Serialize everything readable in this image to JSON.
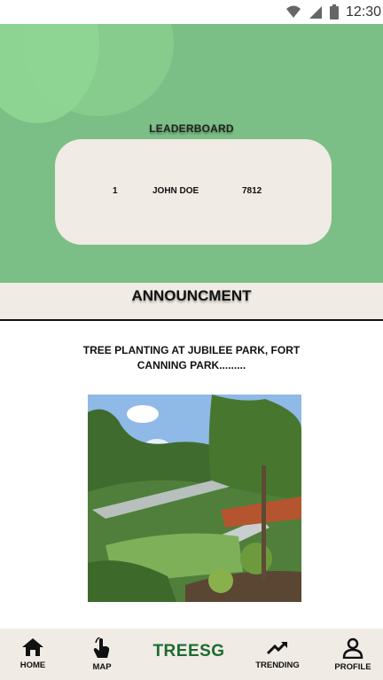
{
  "status_bar": {
    "time": "12:30"
  },
  "leaderboard": {
    "title": "LEADERBOARD",
    "entries": [
      {
        "rank": "1",
        "name": "JOHN DOE",
        "score": "7812"
      }
    ]
  },
  "announcement": {
    "title": "ANNOUNCMENT",
    "text": "TREE PLANTING AT JUBILEE PARK, FORT CANNING PARK........."
  },
  "nav": {
    "home": "HOME",
    "map": "MAP",
    "brand": "TREESG",
    "trending": "TRENDING",
    "profile": "PROFILE"
  },
  "colors": {
    "hero": "#7cbf86",
    "card": "#f0ebe4",
    "brand": "#1c6b32"
  }
}
